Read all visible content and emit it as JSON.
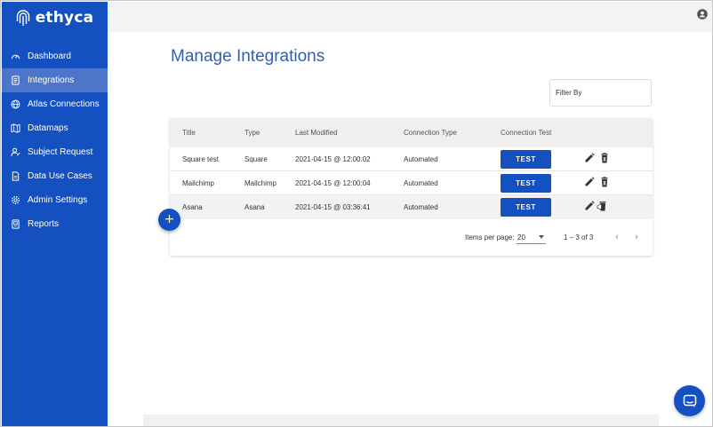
{
  "brand": {
    "name": "ethyca"
  },
  "sidebar": {
    "items": [
      {
        "label": "Dashboard",
        "icon": "dashboard-icon",
        "active": false
      },
      {
        "label": "Integrations",
        "icon": "document-icon",
        "active": true
      },
      {
        "label": "Atlas Connections",
        "icon": "globe-icon",
        "active": false
      },
      {
        "label": "Datamaps",
        "icon": "map-icon",
        "active": false
      },
      {
        "label": "Subject Request",
        "icon": "person-icon",
        "active": false
      },
      {
        "label": "Data Use Cases",
        "icon": "file-icon",
        "active": false
      },
      {
        "label": "Admin Settings",
        "icon": "gear-icon",
        "active": false
      },
      {
        "label": "Reports",
        "icon": "report-icon",
        "active": false
      }
    ]
  },
  "page": {
    "title": "Manage Integrations",
    "filter_label": "Filter By"
  },
  "table": {
    "columns": [
      "Title",
      "Type",
      "Last Modified",
      "Connection Type",
      "Connection Test"
    ],
    "test_label": "TEST",
    "rows": [
      {
        "title": "Square test",
        "type": "Square",
        "last_modified": "2021-04-15 @ 12:00:02",
        "connection_type": "Automated"
      },
      {
        "title": "Mailchimp",
        "type": "Mailchimp",
        "last_modified": "2021-04-15 @ 12:00:04",
        "connection_type": "Automated"
      },
      {
        "title": "Asana",
        "type": "Asana",
        "last_modified": "2021-04-15 @ 03:36:41",
        "connection_type": "Automated"
      }
    ]
  },
  "paginator": {
    "items_per_page_label": "Items per page:",
    "items_per_page": "20",
    "range": "1 – 3 of 3"
  },
  "fab": {
    "label": "+"
  },
  "colors": {
    "primary": "#1550c0",
    "title": "#2f5fb5",
    "active_nav": "#4d76c9"
  }
}
